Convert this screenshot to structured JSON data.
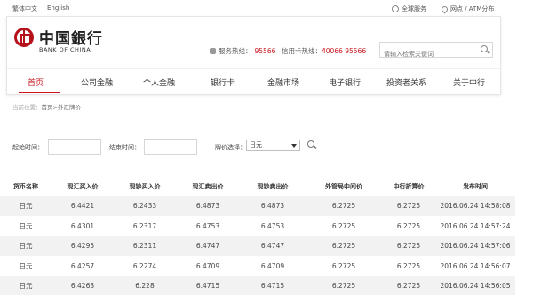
{
  "topbar": {
    "lang_traditional": "繁体中文",
    "lang_english": "English",
    "global_service": "全球服务",
    "outlets_atm": "网点 / ATM分布"
  },
  "header": {
    "logo_cn": "中国銀行",
    "logo_en": "BANK OF CHINA",
    "service_hotline_label": "服务热线：",
    "service_hotline_number": "95566",
    "card_hotline_label": "信用卡热线：",
    "card_hotline_number": "40066 95566",
    "search_placeholder": "请输入检索关键词"
  },
  "nav": {
    "items": [
      {
        "label": "首页"
      },
      {
        "label": "公司金融"
      },
      {
        "label": "个人金融"
      },
      {
        "label": "银行卡"
      },
      {
        "label": "金融市场"
      },
      {
        "label": "电子银行"
      },
      {
        "label": "投资者关系"
      },
      {
        "label": "关于中行"
      }
    ],
    "active": "首页"
  },
  "breadcrumb": {
    "location": "当前位置：",
    "current": "首页>外汇牌价"
  },
  "filters": {
    "start_label": "起始时间：",
    "end_label": "结束时间：",
    "currency_label": "牌价选择：",
    "currency_selected": "日元"
  },
  "table": {
    "headers": [
      "货币名称",
      "现汇买入价",
      "现钞买入价",
      "现汇卖出价",
      "现钞卖出价",
      "外管局中间价",
      "中行折算价",
      "发布时间"
    ],
    "rows": [
      [
        "日元",
        "6.4421",
        "6.2433",
        "6.4873",
        "6.4873",
        "6.2725",
        "6.2725",
        "2016.06.24 14:58:08"
      ],
      [
        "日元",
        "6.4301",
        "6.2317",
        "6.4753",
        "6.4753",
        "6.2725",
        "6.2725",
        "2016.06.24 14:57:24"
      ],
      [
        "日元",
        "6.4295",
        "6.2311",
        "6.4747",
        "6.4747",
        "6.2725",
        "6.2725",
        "2016.06.24 14:57:06"
      ],
      [
        "日元",
        "6.4257",
        "6.2274",
        "6.4709",
        "6.4709",
        "6.2725",
        "6.2725",
        "2016.06.24 14:56:07"
      ],
      [
        "日元",
        "6.4263",
        "6.228",
        "6.4715",
        "6.4715",
        "6.2725",
        "6.2725",
        "2016.06.24 14:56:05"
      ]
    ]
  },
  "colors": {
    "brand_red": "#c8161d"
  }
}
